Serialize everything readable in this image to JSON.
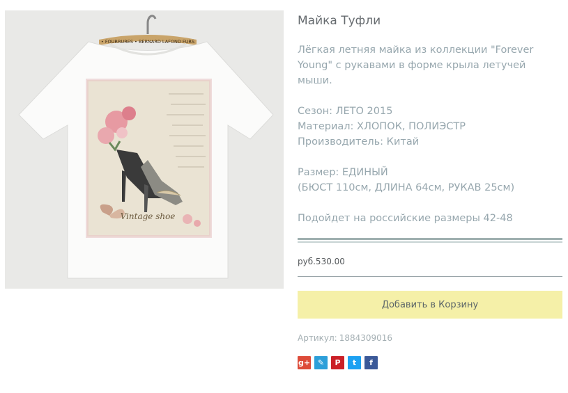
{
  "product": {
    "title": "Майка Туфли",
    "description_lines": [
      "Лёгкая летняя майка из коллекции \"Forever",
      "Young\" с рукавами в форме крыла летучей",
      "мыши."
    ],
    "season": "Сезон: ЛЕТО 2015",
    "material": "Материал: ХЛОПОК, ПОЛИЭСТР",
    "manufacturer": "Производитель: Китай",
    "size": "Размер: ЕДИНЫЙ",
    "measurements": "(БЮСТ 110см, ДЛИНА 64см, РУКАВ 25см)",
    "fit_note": "Подойдет на российские размеры 42-48",
    "price": "руб.530.00",
    "add_to_cart_label": "Добавить в Корзину",
    "sku_label": "Артикул:",
    "sku_value": "1884309016"
  },
  "image": {
    "hanger_label": "• FOURRURES • BERNARD LAFOND FURS",
    "print_text": "Vintage shoe"
  },
  "share": [
    {
      "name": "google-plus",
      "glyph": "g+",
      "color": "#dd4b39"
    },
    {
      "name": "livejournal",
      "glyph": "✎",
      "color": "#2d9fd9"
    },
    {
      "name": "pinterest",
      "glyph": "P",
      "color": "#cb2027"
    },
    {
      "name": "twitter",
      "glyph": "t",
      "color": "#1da1f2"
    },
    {
      "name": "facebook",
      "glyph": "f",
      "color": "#3b5998"
    }
  ],
  "colors": {
    "accent_button": "#f5f0a8",
    "text_muted": "#97a7ae"
  }
}
